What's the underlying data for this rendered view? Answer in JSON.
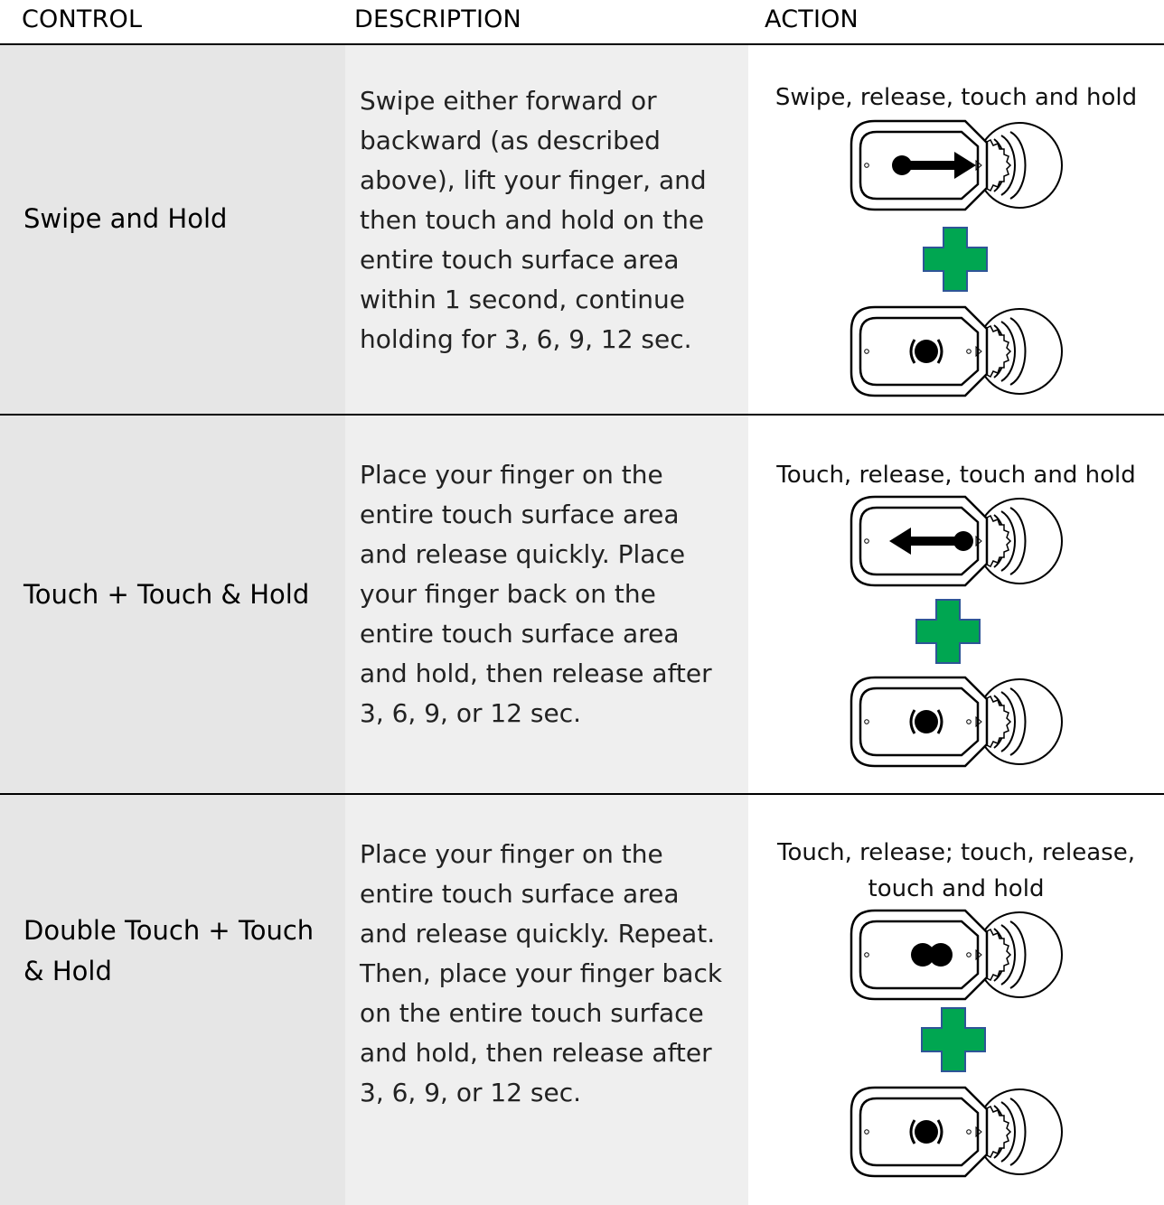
{
  "header": {
    "control": "CONTROL",
    "description": "DESCRIPTION",
    "action": "ACTION"
  },
  "rows": [
    {
      "control": "Swipe and Hold",
      "description": [
        "Swipe either forward or",
        "backward (as described",
        "above), lift your finger, and",
        "then touch and hold on the",
        "entire touch surface area",
        "within 1 second, continue",
        "holding for 3, 6, 9, 12 sec."
      ],
      "action_label": [
        "Swipe, release, touch and hold"
      ],
      "top_icon": "swipe-forward-arrow-icon",
      "bottom_icon": "touch-and-hold-icon"
    },
    {
      "control": "Touch + Touch & Hold",
      "description": [
        "Place your finger on the",
        "entire touch surface area",
        "and release quickly. Place",
        "your finger back on the",
        "entire touch surface area",
        "and hold, then release after",
        "3, 6, 9, or 12 sec."
      ],
      "action_label": [
        "Touch, release, touch and hold"
      ],
      "top_icon": "swipe-backward-arrow-icon",
      "bottom_icon": "touch-and-hold-icon"
    },
    {
      "control": [
        "Double Touch + Touch",
        "& Hold"
      ],
      "description": [
        "Place your finger on the",
        "entire touch surface area",
        "and release quickly. Repeat.",
        "Then, place your finger back",
        "on the entire touch surface",
        "and hold, then release after",
        "3, 6, 9, or 12 sec."
      ],
      "action_label": [
        "Touch, release; touch, release,",
        "touch and hold"
      ],
      "top_icon": "double-touch-icon",
      "bottom_icon": "touch-and-hold-icon"
    }
  ],
  "colors": {
    "plus_fill": "#00a651",
    "plus_stroke": "#2e5597",
    "control_col_bg": "#e6e6e6",
    "description_col_bg": "#efefef"
  }
}
